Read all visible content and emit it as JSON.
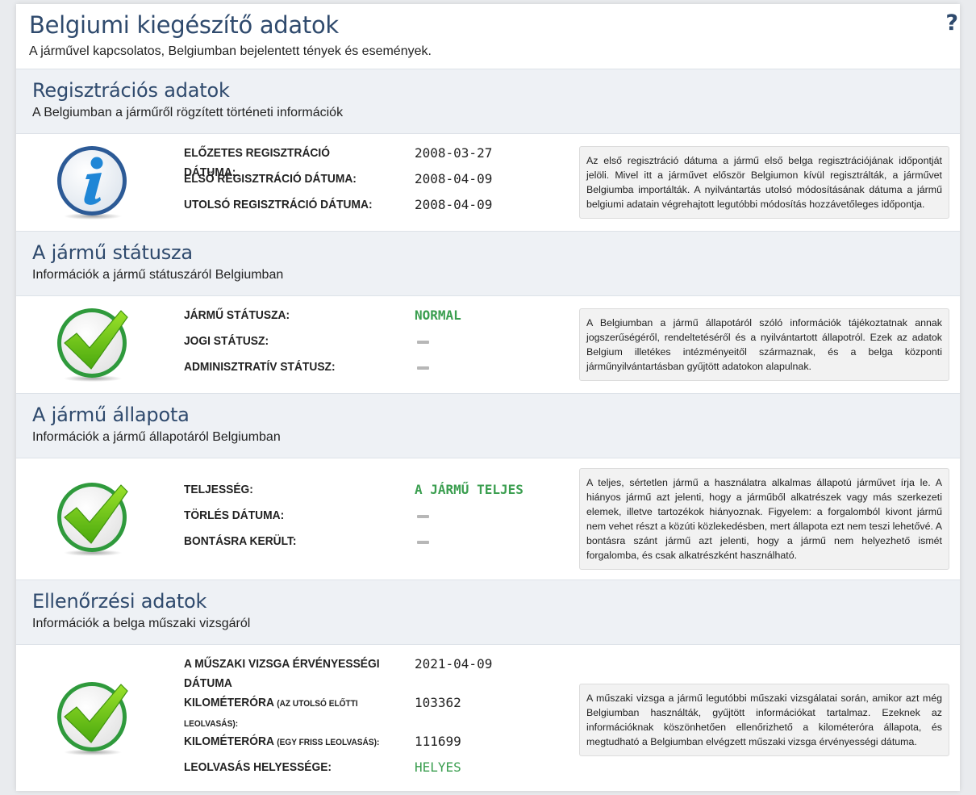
{
  "page": {
    "title": "Belgiumi kiegészítő adatok",
    "subtitle": "A járművel kapcsolatos, Belgiumban bejelentett tények és események.",
    "help_icon": "?"
  },
  "sections": [
    {
      "title": "Regisztrációs adatok",
      "subtitle": "A Belgiumban a járműről rögzített történeti információk",
      "icon": "info-icon",
      "rows": [
        {
          "label": "Előzetes regisztráció dátuma:",
          "value": "2008-03-27"
        },
        {
          "label": "Első regisztráció dátuma:",
          "value": "2008-04-09"
        },
        {
          "label": "Utolsó regisztráció dátuma:",
          "value": "2008-04-09"
        }
      ],
      "note": "Az első regisztráció dátuma a jármű első belga regisztrációjának időpontját jelöli. Mivel itt a járművet először Belgiumon kívül regisztrálták, a járművet Belgiumba importálták. A nyilvántartás utolsó módosításának dátuma a jármű belgiumi adatain végrehajtott legutóbbi módosítás hozzávetőleges időpontja."
    },
    {
      "title": "A jármű státusza",
      "subtitle": "Információk a jármű státuszáról Belgiumban",
      "icon": "checkmark-icon",
      "rows": [
        {
          "label": "Jármű státusza:",
          "value": "NORMAL"
        },
        {
          "label": "Jogi státusz:",
          "value": "—"
        },
        {
          "label": "Adminisztratív státusz:",
          "value": "—"
        }
      ],
      "note": "A Belgiumban a jármű állapotáról szóló információk tájékoztatnak annak jogszerűségéről, rendeltetéséről és a nyilvántartott állapotról. Ezek az adatok Belgium illetékes intézményeitől származnak, és a belga központi járműnyilvántartásban gyűjtött adatokon alapulnak."
    },
    {
      "title": "A jármű állapota",
      "subtitle": "Információk a jármű állapotáról Belgiumban",
      "icon": "checkmark-icon",
      "rows": [
        {
          "label": "Teljesség:",
          "value": "A JÁRMŰ TELJES"
        },
        {
          "label": "Törlés dátuma:",
          "value": "—"
        },
        {
          "label": "Bontásra került:",
          "value": "—"
        }
      ],
      "note": "A teljes, sértetlen jármű a használatra alkalmas állapotú járművet írja le. A hiányos jármű azt jelenti, hogy a járműből alkatrészek vagy más szerkezeti elemek, illetve tartozékok hiányoznak. Figyelem: a forgalomból kivont jármű nem vehet részt a közúti közlekedésben, mert állapota ezt nem teszi lehetővé. A bontásra szánt jármű azt jelenti, hogy a jármű nem helyezhető ismét forgalomba, és csak alkatrészként használható."
    },
    {
      "title": "Ellenőrzési adatok",
      "subtitle": "Információk a belga műszaki vizsgáról",
      "icon": "checkmark-icon",
      "rows": [
        {
          "label": "A műszaki vizsga érvényességi dátuma",
          "value": "2021-04-09"
        },
        {
          "label": "Kilométeróra",
          "label_small": "(az utolsó előtti leolvasás):",
          "value": "103362"
        },
        {
          "label": "Kilométeróra",
          "label_small": "(egy friss leolvasás):",
          "value": "111699"
        },
        {
          "label": "Leolvasás helyessége:",
          "value": "HELYES"
        }
      ],
      "note": "A műszaki vizsga a jármű legutóbbi műszaki vizsgálatai során, amikor azt még Belgiumban használták, gyűjtött információkat tartalmaz. Ezeknek az információknak köszönhetően ellenőrizhető a kilométeróra állapota, és megtudható a Belgiumban elvégzett műszaki vizsga érvényességi dátuma."
    }
  ],
  "colors": {
    "title": "#2f4a6d",
    "green_value": "#3a9e4f",
    "section_bg": "#eef1f5",
    "note_bg": "#f2f2f2"
  }
}
